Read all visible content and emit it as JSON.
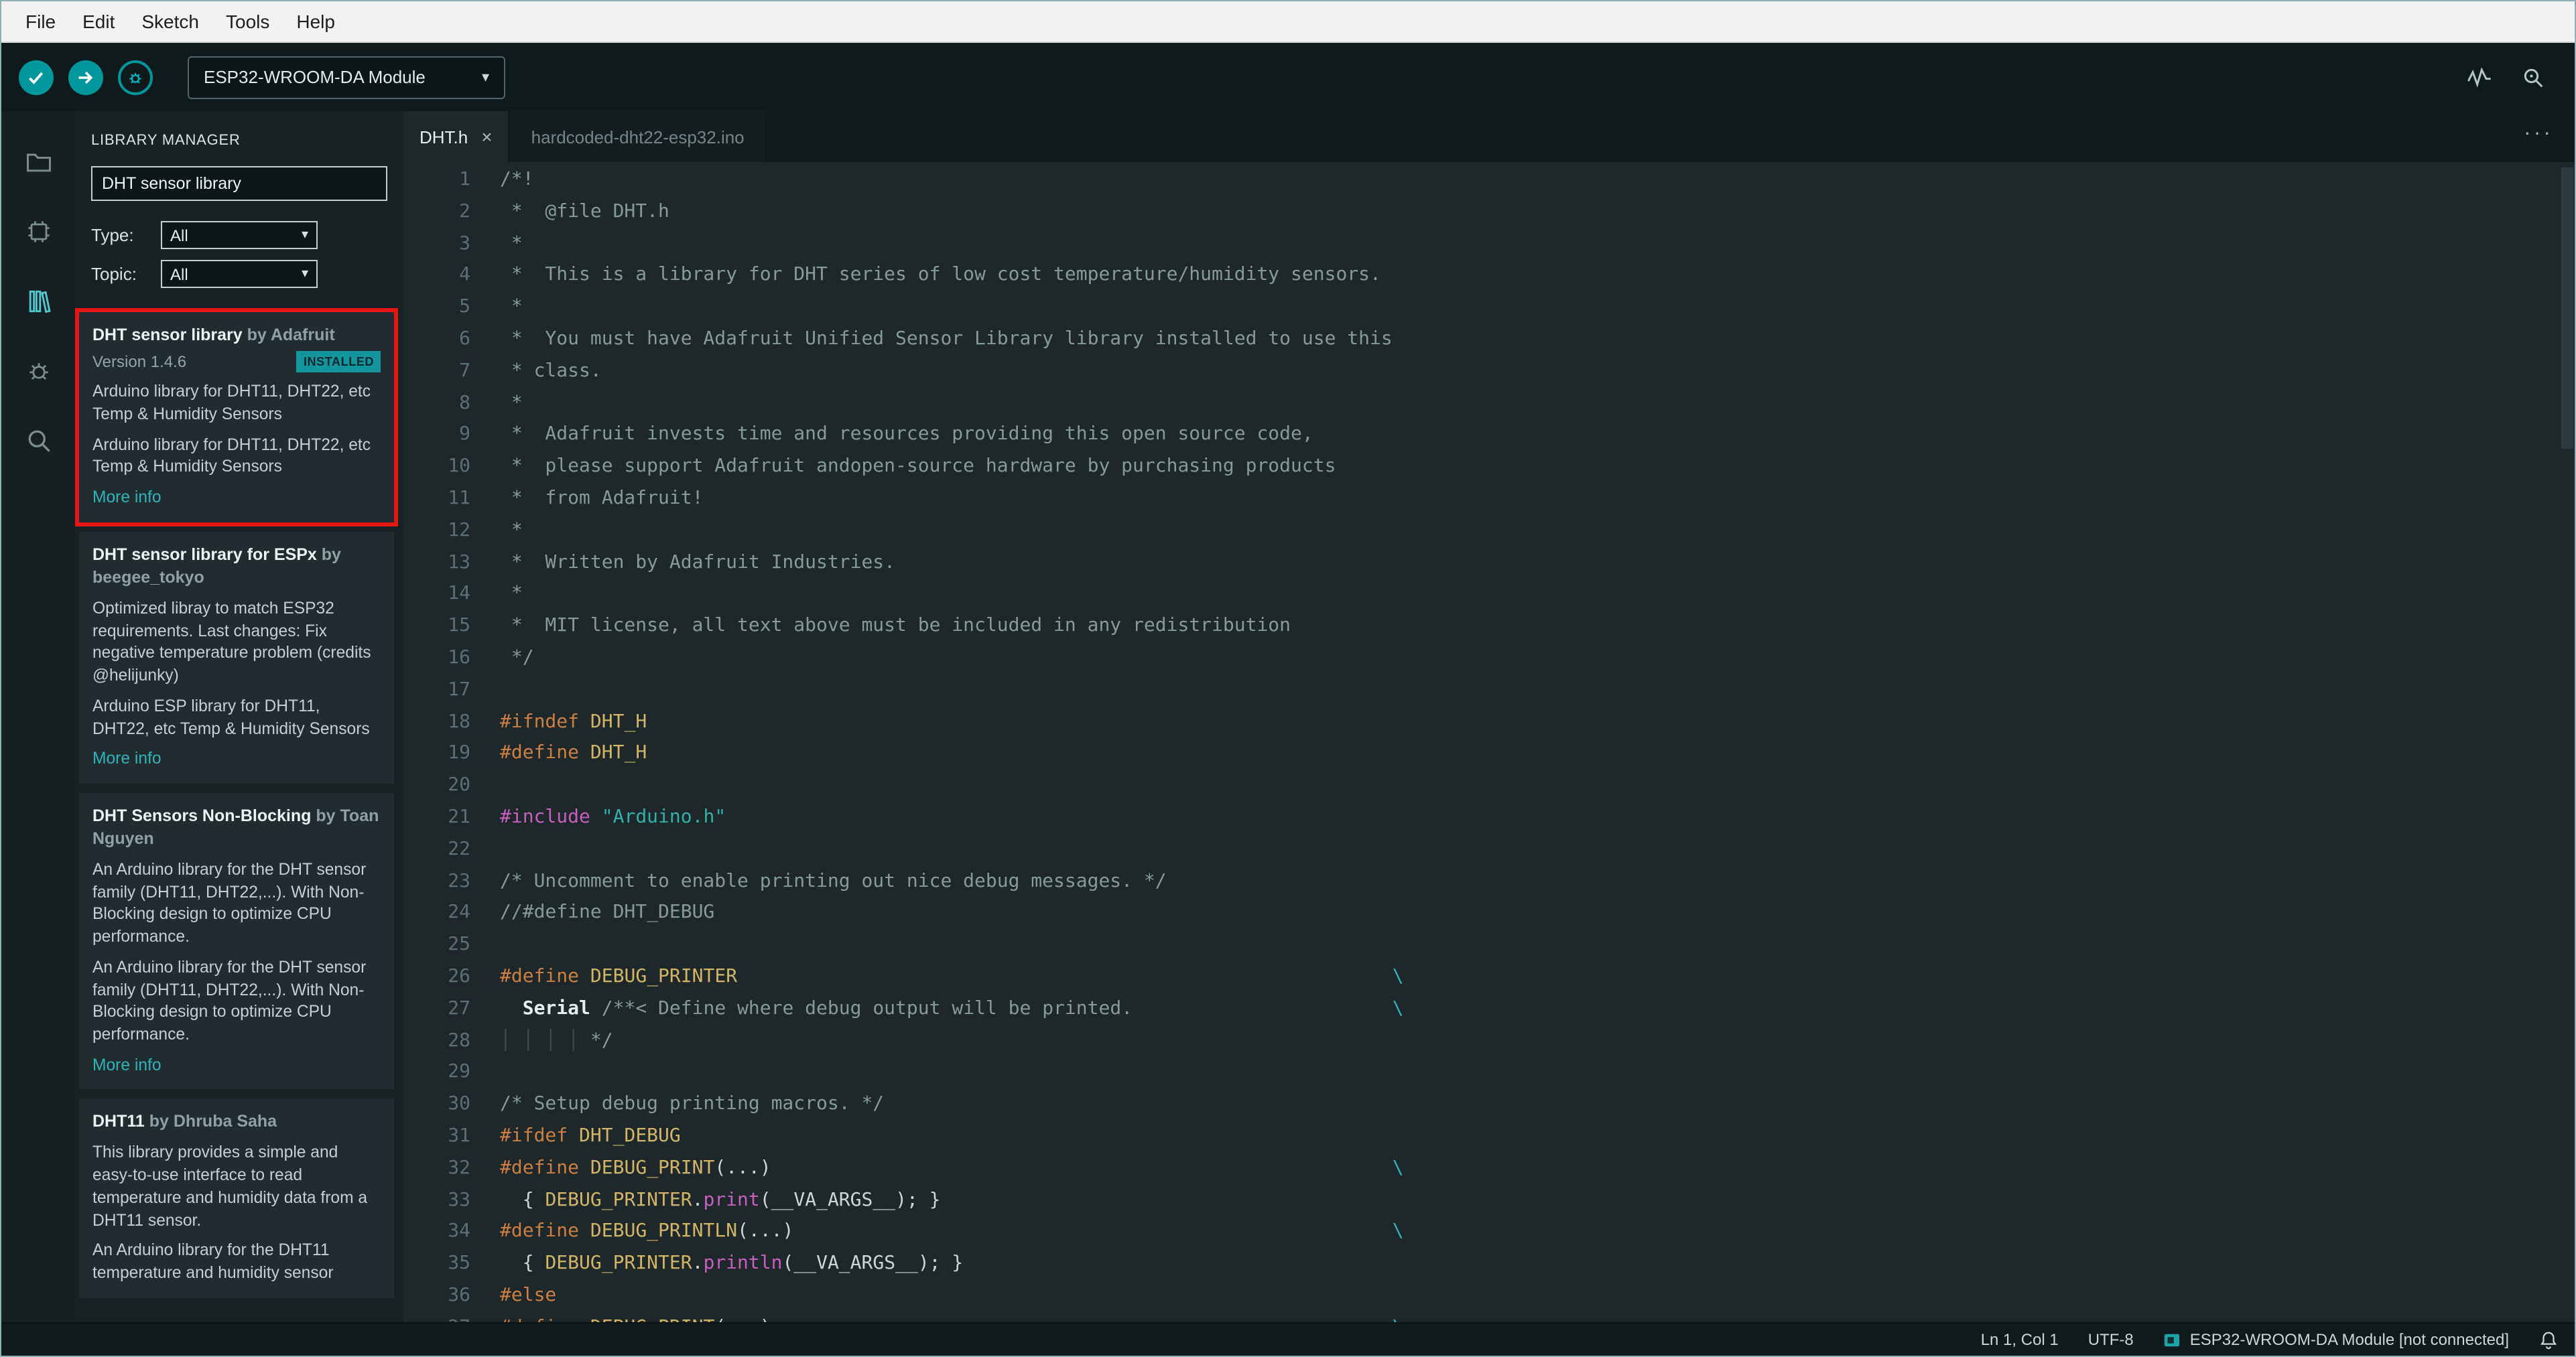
{
  "menu": [
    "File",
    "Edit",
    "Sketch",
    "Tools",
    "Help"
  ],
  "toolbar": {
    "board_selector": "ESP32-WROOM-DA Module",
    "icons": [
      "verify-check",
      "upload-arrow",
      "debug-circle",
      "serial-plotter-pulse",
      "serial-monitor-magnifier"
    ]
  },
  "sidebar_icons": [
    "sketchbook-folder",
    "boards-manager-chip",
    "library-manager-books",
    "debug-bug",
    "search-magnifier"
  ],
  "library_manager": {
    "title": "LIBRARY MANAGER",
    "search_value": "DHT sensor library",
    "filters": [
      {
        "label": "Type:",
        "value": "All"
      },
      {
        "label": "Topic:",
        "value": "All"
      }
    ],
    "cards": [
      {
        "title": "DHT sensor library",
        "author": "by Adafruit",
        "version": "Version 1.4.6",
        "badge": "INSTALLED",
        "description": [
          "Arduino library for DHT11, DHT22, etc Temp & Humidity Sensors",
          "Arduino library for DHT11, DHT22, etc Temp & Humidity Sensors"
        ],
        "more_info": "More info",
        "highlighted": true
      },
      {
        "title": "DHT sensor library for ESPx",
        "author": "by beegee_tokyo",
        "description": [
          "Optimized libray to match ESP32 requirements. Last changes: Fix negative temperature problem (credits @helijunky)",
          "Arduino ESP library for DHT11, DHT22, etc Temp & Humidity Sensors"
        ],
        "more_info": "More info"
      },
      {
        "title": "DHT Sensors Non-Blocking",
        "author": "by Toan Nguyen",
        "description": [
          "An Arduino library for the DHT sensor family (DHT11, DHT22,...). With Non-Blocking design to optimize CPU performance.",
          "An Arduino library for the DHT sensor family (DHT11, DHT22,...). With Non-Blocking design to optimize CPU performance."
        ],
        "more_info": "More info"
      },
      {
        "title": "DHT11",
        "author": "by Dhruba Saha",
        "description": [
          "This library provides a simple and easy-to-use interface to read temperature and humidity data from a DHT11 sensor.",
          "An Arduino library for the DHT11 temperature and humidity sensor"
        ]
      }
    ]
  },
  "editor": {
    "tabs": [
      {
        "label": "DHT.h",
        "active": true
      },
      {
        "label": "hardcoded-dht22-esp32.ino",
        "active": false
      }
    ],
    "code": [
      [
        [
          "c",
          "/*!"
        ]
      ],
      [
        [
          "c",
          " *  @file DHT.h"
        ]
      ],
      [
        [
          "c",
          " *"
        ]
      ],
      [
        [
          "c",
          " *  This is a library for DHT series of low cost temperature/humidity sensors."
        ]
      ],
      [
        [
          "c",
          " *"
        ]
      ],
      [
        [
          "c",
          " *  You must have Adafruit Unified Sensor Library library installed to use this"
        ]
      ],
      [
        [
          "c",
          " * class."
        ]
      ],
      [
        [
          "c",
          " *"
        ]
      ],
      [
        [
          "c",
          " *  Adafruit invests time and resources providing this open source code,"
        ]
      ],
      [
        [
          "c",
          " *  please support Adafruit andopen-source hardware by purchasing products"
        ]
      ],
      [
        [
          "c",
          " *  from Adafruit!"
        ]
      ],
      [
        [
          "c",
          " *"
        ]
      ],
      [
        [
          "c",
          " *  Written by Adafruit Industries."
        ]
      ],
      [
        [
          "c",
          " *"
        ]
      ],
      [
        [
          "c",
          " *  MIT license, all text above must be included in any redistribution"
        ]
      ],
      [
        [
          "c",
          " */"
        ]
      ],
      [],
      [
        [
          "pp",
          "#ifndef"
        ],
        [
          "d",
          " "
        ],
        [
          "m",
          "DHT_H"
        ]
      ],
      [
        [
          "pp",
          "#define"
        ],
        [
          "d",
          " "
        ],
        [
          "m",
          "DHT_H"
        ]
      ],
      [],
      [
        [
          "inc",
          "#include"
        ],
        [
          "d",
          " "
        ],
        [
          "s",
          "\"Arduino.h\""
        ]
      ],
      [],
      [
        [
          "c",
          "/* Uncomment to enable printing out nice debug messages. */"
        ]
      ],
      [
        [
          "c",
          "//#define DHT_DEBUG"
        ]
      ],
      [],
      [
        [
          "pp",
          "#define"
        ],
        [
          "d",
          " "
        ],
        [
          "m",
          "DEBUG_PRINTER"
        ],
        [
          "x",
          "\\"
        ]
      ],
      [
        [
          "d",
          "  "
        ],
        [
          "b",
          "Serial"
        ],
        [
          "d",
          " "
        ],
        [
          "c",
          "/**< Define where debug output will be printed."
        ],
        [
          "x",
          "\\"
        ]
      ],
      [
        [
          "g",
          "│ │ │ │ "
        ],
        [
          "c",
          "*/"
        ]
      ],
      [],
      [
        [
          "c",
          "/* Setup debug printing macros. */"
        ]
      ],
      [
        [
          "pp",
          "#ifdef"
        ],
        [
          "d",
          " "
        ],
        [
          "m",
          "DHT_DEBUG"
        ]
      ],
      [
        [
          "pp",
          "#define"
        ],
        [
          "d",
          " "
        ],
        [
          "m",
          "DEBUG_PRINT"
        ],
        [
          "d",
          "(...)"
        ],
        [
          "x",
          "\\"
        ]
      ],
      [
        [
          "d",
          "  { "
        ],
        [
          "m",
          "DEBUG_PRINTER"
        ],
        [
          "d",
          "."
        ],
        [
          "inc",
          "print"
        ],
        [
          "d",
          "("
        ],
        [
          "v",
          "__VA_ARGS__"
        ],
        [
          "d",
          "); }"
        ]
      ],
      [
        [
          "pp",
          "#define"
        ],
        [
          "d",
          " "
        ],
        [
          "m",
          "DEBUG_PRINTLN"
        ],
        [
          "d",
          "(...)"
        ],
        [
          "x",
          "\\"
        ]
      ],
      [
        [
          "d",
          "  { "
        ],
        [
          "m",
          "DEBUG_PRINTER"
        ],
        [
          "d",
          "."
        ],
        [
          "inc",
          "println"
        ],
        [
          "d",
          "("
        ],
        [
          "v",
          "__VA_ARGS__"
        ],
        [
          "d",
          "); }"
        ]
      ],
      [
        [
          "pp",
          "#else"
        ]
      ],
      [
        [
          "pp",
          "#define"
        ],
        [
          "d",
          " "
        ],
        [
          "m",
          "DEBUG_PRINT"
        ],
        [
          "d",
          "(...)"
        ],
        [
          "x",
          "\\"
        ]
      ]
    ]
  },
  "status_bar": {
    "cursor": "Ln 1, Col 1",
    "encoding": "UTF-8",
    "board": "ESP32-WROOM-DA Module [not connected]",
    "icons": [
      "board-connected-square",
      "notifications-bell"
    ]
  },
  "icons": {
    "caret_down": "▾",
    "close": "×",
    "more_actions": "···"
  },
  "colors": {
    "accent_teal": "#00979d",
    "annotation_red": "#e51616",
    "badge_bg": "#13969c",
    "link_teal": "#2fb4bb"
  }
}
